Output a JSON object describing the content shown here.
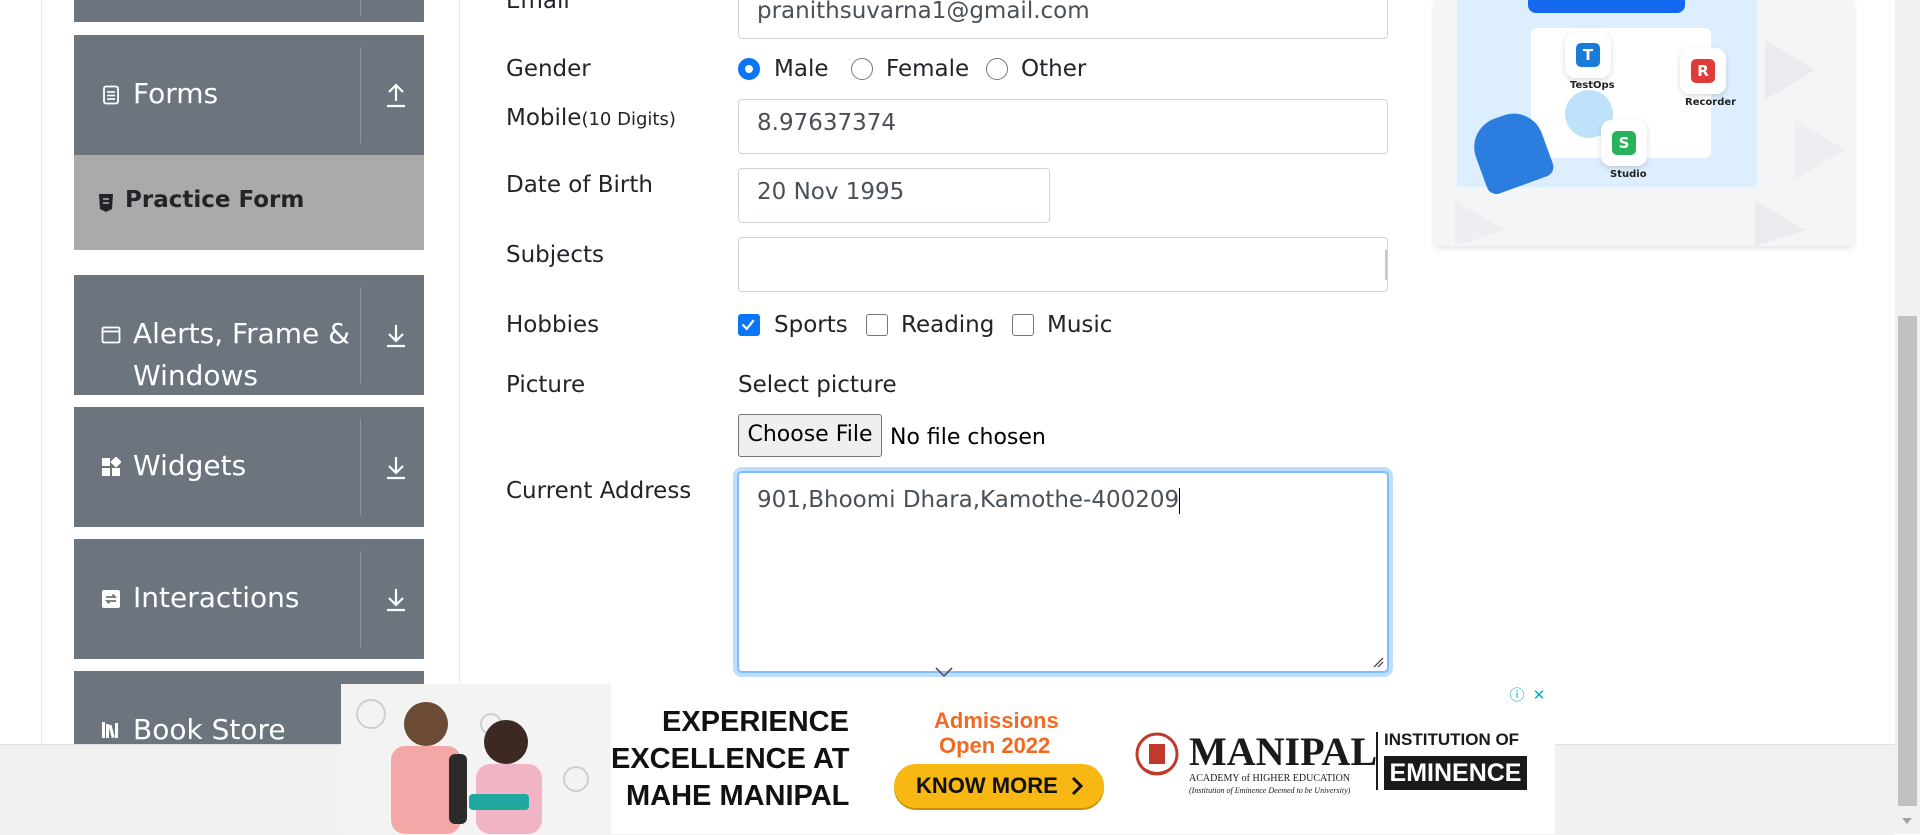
{
  "sidebar": {
    "forms": "Forms",
    "practice_form": "Practice Form",
    "alerts_line1": "Alerts, Frame &",
    "alerts_line2": "Windows",
    "widgets": "Widgets",
    "interactions": "Interactions",
    "book_store": "Book Store"
  },
  "form": {
    "email_label": "Email",
    "email_value": "pranithsuvarna1@gmail.com",
    "gender_label": "Gender",
    "gender_options": [
      "Male",
      "Female",
      "Other"
    ],
    "gender_selected": "Male",
    "mobile_label": "Mobile",
    "mobile_hint": "(10 Digits)",
    "mobile_value": "8.97637374",
    "dob_label": "Date of Birth",
    "dob_value": "20 Nov 1995",
    "subjects_label": "Subjects",
    "subjects_value": "",
    "hobbies_label": "Hobbies",
    "hobbies": [
      {
        "label": "Sports",
        "checked": true
      },
      {
        "label": "Reading",
        "checked": false
      },
      {
        "label": "Music",
        "checked": false
      }
    ],
    "picture_label": "Picture",
    "select_picture": "Select picture",
    "choose_file": "Choose File",
    "no_file": "No file chosen",
    "address_label": "Current Address",
    "address_value": "901,Bhoomi Dhara,Kamothe-400209"
  },
  "right_ad": {
    "testops": "TestOps",
    "recorder": "Recorder",
    "studio": "Studio"
  },
  "bottom_ad": {
    "headline_1": "EXPERIENCE",
    "headline_2": "EXCELLENCE AT",
    "headline_3": "MAHE MANIPAL",
    "admissions_1": "Admissions",
    "admissions_2": "Open 2022",
    "cta": "KNOW MORE",
    "brand": "MANIPAL",
    "brand_sub": "ACADEMY of HIGHER EDUCATION",
    "brand_tag": "(Institution of Eminence Deemed to be University)",
    "institution_of": "INSTITUTION OF",
    "eminence": "EMINENCE"
  },
  "colors": {
    "sidebar_bg": "#6c757d",
    "active_item_bg": "#aaaaaa",
    "accent_blue": "#0a76f6",
    "ad_orange": "#f26a21",
    "ad_yellow": "#f7b813"
  }
}
